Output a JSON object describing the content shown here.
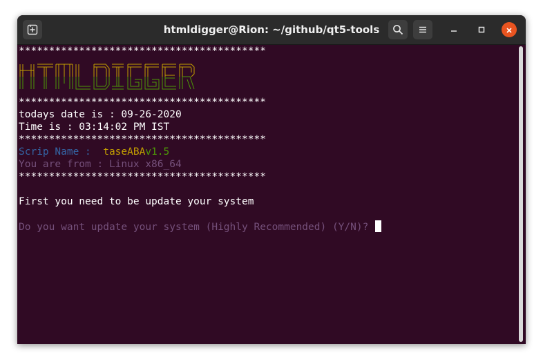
{
  "window": {
    "title": "htmldigger@Rion: ~/github/qt5-tools"
  },
  "icons": {
    "new_tab": "new-tab-icon",
    "search": "search-icon",
    "menu": "hamburger-menu-icon",
    "minimize": "minimize-icon",
    "maximize": "maximize-icon",
    "close": "close-icon"
  },
  "colors": {
    "terminal_bg": "#300a24",
    "titlebar_bg": "#2b2b2b",
    "close_button": "#e95420",
    "logo_yellow": "#c4a000",
    "logo_green": "#4e9a06",
    "text_blue": "#3465a4",
    "text_dim": "#75507b"
  },
  "terminal": {
    "separator": "*****************************************",
    "logo_text": "HTMLDIGGER",
    "date_line": "todays date is : 09-26-2020",
    "time_line": "Time is : 03:14:02 PM IST",
    "script_label": "Scrip Name :  ",
    "script_name": "taseABA",
    "script_version": "v1.5",
    "from_line": "You are from : Linux x86_64",
    "update_notice": "First you need to be update your system",
    "prompt": "Do you want update your system (Highly Recommended) (Y/N)? "
  }
}
